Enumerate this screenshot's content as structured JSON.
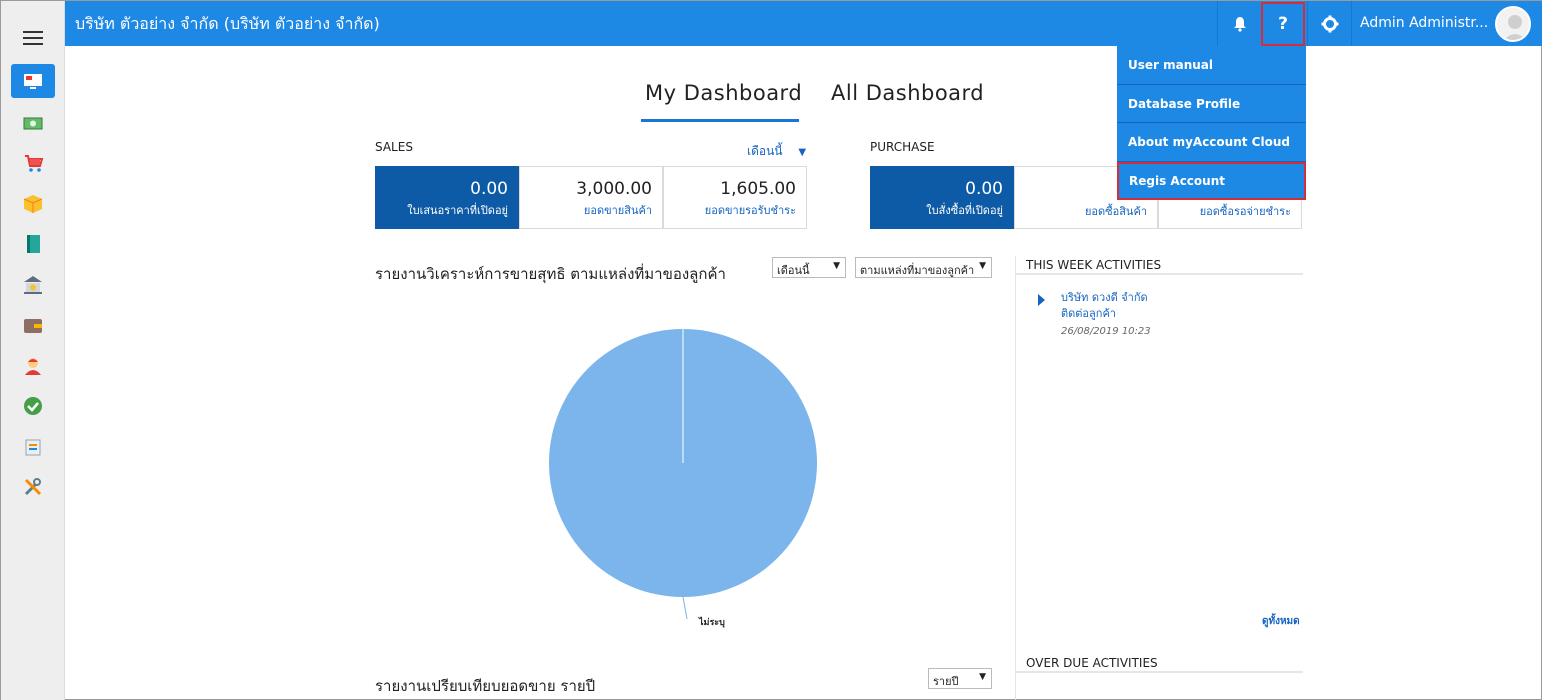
{
  "app": {
    "company": "บริษัท ตัวอย่าง จำกัด (บริษัท ตัวอย่าง จำกัด)",
    "user_name": "Admin Administr...",
    "accent": "#1e88e5"
  },
  "topbar": {
    "bell_icon": "bell-icon",
    "help_label": "?",
    "settings_icon": "gear-icon"
  },
  "help_menu": {
    "items": [
      {
        "label": "User manual"
      },
      {
        "label": "Database Profile"
      },
      {
        "label": "About myAccount Cloud"
      },
      {
        "label": "Regis Account"
      }
    ]
  },
  "tabs": [
    {
      "label": "My Dashboard",
      "active": true
    },
    {
      "label": "All Dashboard",
      "active": false
    }
  ],
  "sales": {
    "title": "SALES",
    "period": "เดือนนี้",
    "cards": [
      {
        "value": "0.00",
        "label": "ใบเสนอราคาที่เปิดอยู่"
      },
      {
        "value": "3,000.00",
        "label": "ยอดขายสินค้า"
      },
      {
        "value": "1,605.00",
        "label": "ยอดขายรอรับชำระ"
      }
    ]
  },
  "purchase": {
    "title": "PURCHASE",
    "cards": [
      {
        "value": "0.00",
        "label": "ใบสั่งซื้อที่เปิดอยู่"
      },
      {
        "value": "",
        "label": "ยอดซื้อสินค้า"
      },
      {
        "value": "",
        "label": "ยอดซื้อรอจ่ายชำระ"
      }
    ]
  },
  "sales_report": {
    "title": "รายงานวิเคราะห์การขายสุทธิ ตามแหล่งที่มาของลูกค้า",
    "period_select": "เดือนนี้",
    "group_select": "ตามแหล่งที่มาของลูกค้า",
    "chart_data": {
      "type": "pie",
      "categories": [
        "ไม่ระบุ"
      ],
      "values": [
        100
      ],
      "colors": [
        "#7cb5ec"
      ]
    }
  },
  "yearly_report": {
    "title": "รายงานเปรียบเทียบยอดขาย รายปี",
    "select": "รายปี"
  },
  "activities": {
    "week_title": "THIS WEEK ACTIVITIES",
    "items": [
      {
        "name": "บริษัท ดวงดี จำกัด",
        "type": "ติดต่อลูกค้า",
        "date": "26/08/2019 10:23"
      }
    ],
    "see_all": "ดูทั้งหมด",
    "overdue_title": "OVER DUE ACTIVITIES"
  },
  "sidebar": {
    "items": [
      {
        "icon": "dashboard-icon",
        "active": true
      },
      {
        "icon": "money-icon"
      },
      {
        "icon": "cart-icon"
      },
      {
        "icon": "box-icon"
      },
      {
        "icon": "book-icon"
      },
      {
        "icon": "bank-icon"
      },
      {
        "icon": "wallet-icon"
      },
      {
        "icon": "contact-icon"
      },
      {
        "icon": "check-icon"
      },
      {
        "icon": "report-icon"
      },
      {
        "icon": "tools-icon"
      }
    ]
  }
}
